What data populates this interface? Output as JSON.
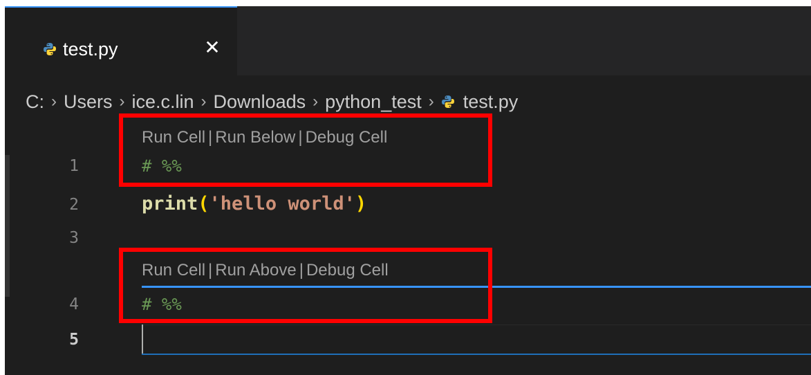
{
  "tab": {
    "label": "test.py",
    "close_glyph": "✕",
    "icon": "python-file-icon"
  },
  "breadcrumb": {
    "items": [
      "C:",
      "Users",
      "ice.c.lin",
      "Downloads",
      "python_test"
    ],
    "separator": "›",
    "file": "test.py",
    "file_icon": "python-file-icon"
  },
  "editor": {
    "line_numbers": [
      "1",
      "2",
      "3",
      "4",
      "5"
    ],
    "active_line": "5",
    "codelens_top": {
      "run_cell": "Run Cell",
      "run_other": "Run Below",
      "debug_cell": "Debug Cell",
      "separator": "|"
    },
    "codelens_bottom": {
      "run_cell": "Run Cell",
      "run_other": "Run Above",
      "debug_cell": "Debug Cell",
      "separator": "|"
    },
    "lines": {
      "line1": "# %%",
      "line2_fn": "print",
      "line2_open": "(",
      "line2_str": "'hello world'",
      "line2_close": ")",
      "line4": "# %%"
    }
  },
  "colors": {
    "background": "#1e1e1e",
    "accent": "#3794ff",
    "comment": "#6a9955",
    "function": "#dcdcaa",
    "string": "#ce9178",
    "bracket": "#ffd700",
    "highlight_box": "#ff0000"
  }
}
